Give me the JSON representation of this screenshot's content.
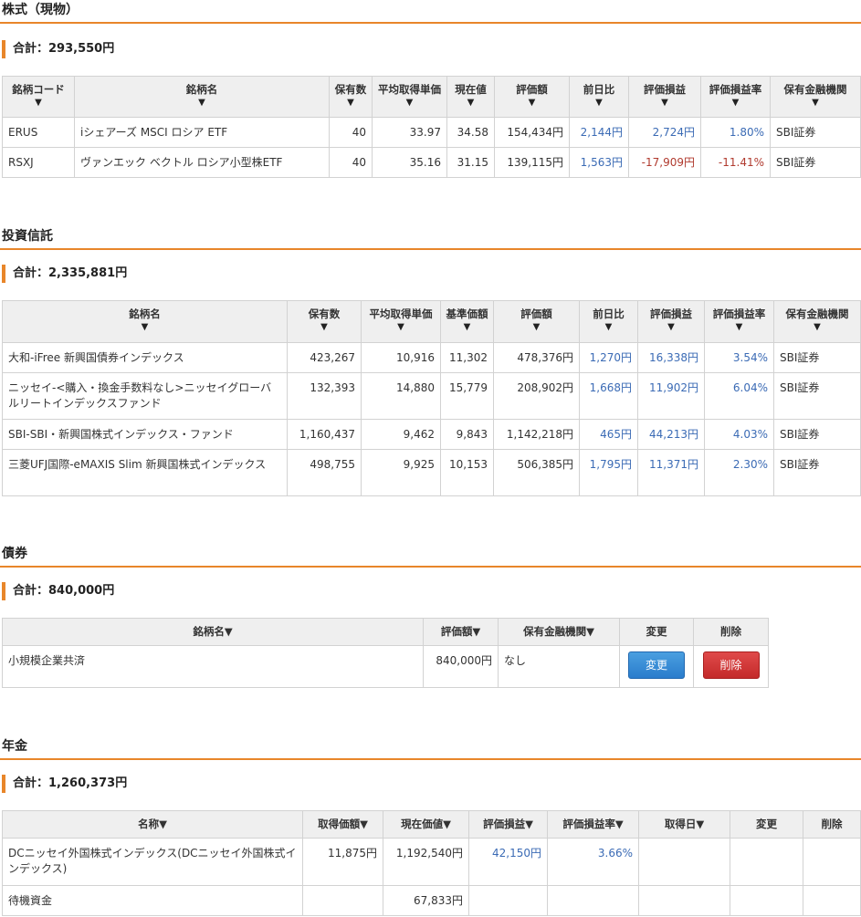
{
  "stocks": {
    "title": "株式（現物）",
    "total": "合計：293,550円",
    "headers": [
      "銘柄コード",
      "銘柄名",
      "保有数",
      "平均取得単価",
      "現在値",
      "評価額",
      "前日比",
      "評価損益",
      "評価損益率",
      "保有金融機関"
    ],
    "rows": [
      {
        "code": "ERUS",
        "name": "iシェアーズ MSCI ロシア ETF",
        "qty": "40",
        "avg": "33.97",
        "price": "34.58",
        "value": "154,434円",
        "change": "2,144円",
        "pl": "2,724円",
        "plrate": "1.80%",
        "inst": "SBI証券"
      },
      {
        "code": "RSXJ",
        "name": "ヴァンエック ベクトル ロシア小型株ETF",
        "qty": "40",
        "avg": "35.16",
        "price": "31.15",
        "value": "139,115円",
        "change": "1,563円",
        "pl": "-17,909円",
        "plrate": "-11.41%",
        "inst": "SBI証券"
      }
    ]
  },
  "funds": {
    "title": "投資信託",
    "total": "合計：2,335,881円",
    "headers": [
      "銘柄名",
      "保有数",
      "平均取得単価",
      "基準価額",
      "評価額",
      "前日比",
      "評価損益",
      "評価損益率",
      "保有金融機関"
    ],
    "rows": [
      {
        "name": "大和-iFree 新興国債券インデックス",
        "qty": "423,267",
        "avg": "10,916",
        "nav": "11,302",
        "value": "478,376円",
        "change": "1,270円",
        "pl": "16,338円",
        "plrate": "3.54%",
        "inst": "SBI証券"
      },
      {
        "name": "ニッセイ-<購入・換金手数料なし>ニッセイグローバルリートインデックスファンド",
        "qty": "132,393",
        "avg": "14,880",
        "nav": "15,779",
        "value": "208,902円",
        "change": "1,668円",
        "pl": "11,902円",
        "plrate": "6.04%",
        "inst": "SBI証券"
      },
      {
        "name": "SBI-SBI・新興国株式インデックス・ファンド",
        "qty": "1,160,437",
        "avg": "9,462",
        "nav": "9,843",
        "value": "1,142,218円",
        "change": "465円",
        "pl": "44,213円",
        "plrate": "4.03%",
        "inst": "SBI証券"
      },
      {
        "name": "三菱UFJ国際-eMAXIS Slim 新興国株式インデックス",
        "qty": "498,755",
        "avg": "9,925",
        "nav": "10,153",
        "value": "506,385円",
        "change": "1,795円",
        "pl": "11,371円",
        "plrate": "2.30%",
        "inst": "SBI証券"
      }
    ]
  },
  "bonds": {
    "title": "債券",
    "total": "合計：840,000円",
    "headers": [
      "銘柄名▼",
      "評価額▼",
      "保有金融機関▼",
      "変更",
      "削除"
    ],
    "rows": [
      {
        "name": "小規模企業共済",
        "value": "840,000円",
        "inst": "なし",
        "edit": "変更",
        "delete": "削除"
      }
    ]
  },
  "pension": {
    "title": "年金",
    "total": "合計：1,260,373円",
    "headers": [
      "名称▼",
      "取得価額▼",
      "現在価値▼",
      "評価損益▼",
      "評価損益率▼",
      "取得日▼",
      "変更",
      "削除"
    ],
    "rows": [
      {
        "name": "DCニッセイ外国株式インデックス(DCニッセイ外国株式インデックス)",
        "cost": "11,875円",
        "current": "1,192,540円",
        "pl": "42,150円",
        "plrate": "3.66%",
        "date": ""
      },
      {
        "name": "待機資金",
        "cost": "",
        "current": "67,833円",
        "pl": "",
        "plrate": "",
        "date": ""
      }
    ]
  },
  "sort_arrow": "▼"
}
